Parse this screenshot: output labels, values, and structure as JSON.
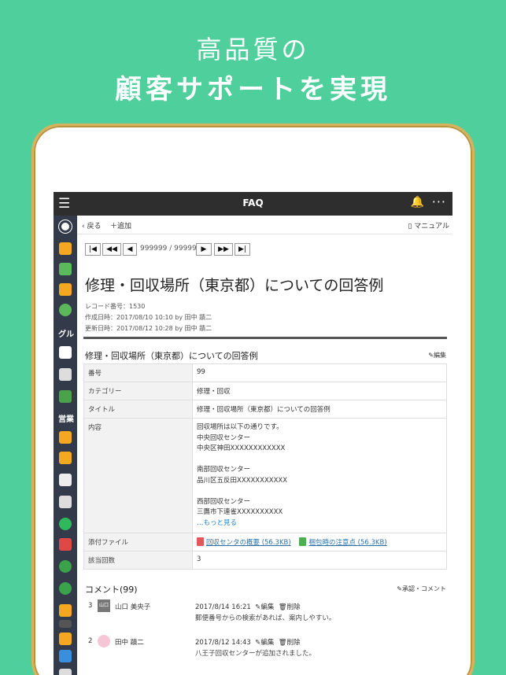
{
  "headline": {
    "line1": "高品質の",
    "line2": "顧客サポートを実現"
  },
  "topbar": {
    "title": "FAQ",
    "more": "···"
  },
  "sidebar": {
    "label_group": "グル",
    "label_sales": "営業"
  },
  "subbar": {
    "back": "戻る",
    "add": "追加",
    "manual": "マニュアル"
  },
  "pager": {
    "first": "|◀",
    "prev_fast": "◀◀",
    "prev": "◀",
    "info": "999999 / 999999",
    "next": "▶",
    "next_fast": "▶▶",
    "last": "▶|"
  },
  "record": {
    "title": "修理・回収場所（東京都）についての回答例",
    "record_no": "レコード番号：1530",
    "created": "作成日時：2017/08/10 10:10 by 田中 蹟二",
    "updated": "更新日時：2017/08/12 10:28 by 田中 蹟二"
  },
  "section": {
    "title": "修理・回収場所（東京都）についての回答例",
    "edit": "編集"
  },
  "fields": {
    "no_label": "番号",
    "no_value": "99",
    "cat_label": "カテゴリー",
    "cat_value": "修理・回収",
    "title_label": "タイトル",
    "title_value": "修理・回収場所（東京都）についての回答例",
    "content_label": "内容",
    "content_lines": [
      "回収場所は以下の通りです。",
      "中央回収センター",
      "中央区神田XXXXXXXXXXXX",
      "",
      "南部回収センター",
      "品川区五反田XXXXXXXXXXX",
      "",
      "西部回収センター",
      "三鷹市下連雀XXXXXXXXXX"
    ],
    "more": "…もっと見る",
    "attach_label": "添付ファイル",
    "attach1": "回収センタの概要 (56.3KB)",
    "attach2": "梱包時の注意点 (56.3KB)",
    "count_label": "該当回数",
    "count_value": "3"
  },
  "comments_header": {
    "title": "コメント(99)",
    "link": "承認・コメント"
  },
  "comments": [
    {
      "num": "3",
      "avatar": "山口",
      "name": "山口 美央子",
      "date": "2017/8/14 16:21",
      "edit": "編集",
      "delete": "削除",
      "text": "郵便番号からの検索があれば、案内しやすい。"
    },
    {
      "num": "2",
      "name": "田中 蹟二",
      "date": "2017/8/12 14:43",
      "edit": "編集",
      "delete": "削除",
      "text": "八王子回収センターが追加されました。"
    }
  ],
  "colors": {
    "background": "#4ecf9b",
    "topbar": "#2e2e2e",
    "sidebar": "#333a4a",
    "link": "#1a7fc9"
  }
}
